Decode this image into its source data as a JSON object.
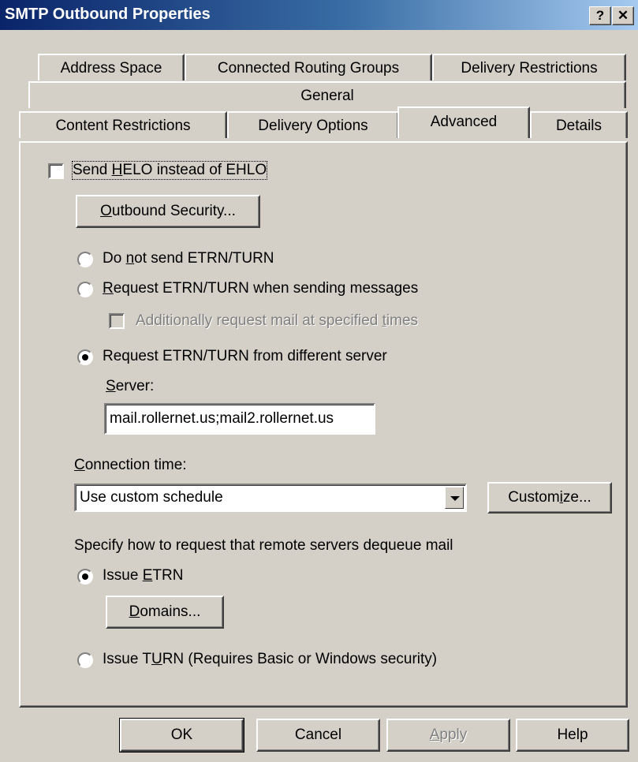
{
  "window": {
    "title": "SMTP Outbound Properties",
    "help_glyph": "?",
    "close_glyph": "✕"
  },
  "tabs": {
    "row1": [
      "Address Space",
      "Connected Routing Groups",
      "Delivery Restrictions"
    ],
    "row2": [
      "General"
    ],
    "row3": [
      "Content Restrictions",
      "Delivery Options",
      "Advanced",
      "Details"
    ],
    "selected": "Advanced"
  },
  "advanced": {
    "helo_checkbox": {
      "label_pre": "Send ",
      "label_key": "H",
      "label_post": "ELO instead of EHLO",
      "checked": false
    },
    "outbound_security_button": {
      "label_key": "O",
      "label_post": "utbound Security..."
    },
    "etrn_options": [
      {
        "pre": "Do ",
        "key": "n",
        "post": "ot send ETRN/TURN",
        "selected": false
      },
      {
        "pre": "",
        "key": "R",
        "post": "equest ETRN/TURN when sending messages",
        "selected": false
      },
      {
        "pre": "Request ETRN/TURN from different server",
        "key": "",
        "post": "",
        "selected": true
      }
    ],
    "additional_request": {
      "pre": "Additionally request mail at specified ",
      "key": "t",
      "post": "imes",
      "enabled": false,
      "checked": false
    },
    "server_label": {
      "key": "S",
      "post": "erver:"
    },
    "server_value": "mail.rollernet.us;mail2.rollernet.us",
    "connection_time_label": {
      "key": "C",
      "post": "onnection time:"
    },
    "connection_time_value": "Use custom schedule",
    "customize_button": {
      "pre": "Custom",
      "key": "i",
      "post": "ze..."
    },
    "dequeue_label": "Specify how to request that remote servers dequeue mail",
    "issue_etrn": {
      "pre": "Issue ",
      "key": "E",
      "post": "TRN",
      "selected": true
    },
    "domains_button": {
      "key": "D",
      "post": "omains..."
    },
    "issue_turn": {
      "pre": "Issue T",
      "key": "U",
      "post": "RN (Requires Basic or Windows security)",
      "selected": false
    }
  },
  "buttons": {
    "ok": "OK",
    "cancel": "Cancel",
    "apply_key": "A",
    "apply_post": "pply",
    "help": "Help"
  }
}
